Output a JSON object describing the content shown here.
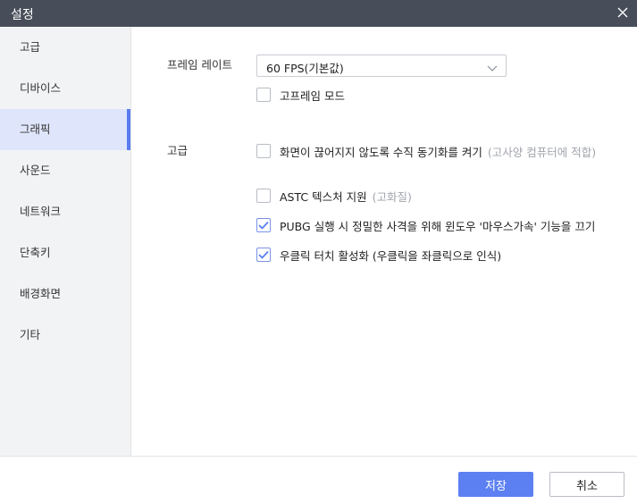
{
  "window": {
    "title": "설정"
  },
  "sidebar": {
    "items": [
      {
        "label": "고급",
        "active": false
      },
      {
        "label": "디바이스",
        "active": false
      },
      {
        "label": "그래픽",
        "active": true
      },
      {
        "label": "사운드",
        "active": false
      },
      {
        "label": "네트워크",
        "active": false
      },
      {
        "label": "단축키",
        "active": false
      },
      {
        "label": "배경화면",
        "active": false
      },
      {
        "label": "기타",
        "active": false
      }
    ]
  },
  "framerate": {
    "label": "프레임 레이트",
    "selected": "60 FPS(기본값)",
    "high_frame_mode": {
      "label": "고프레임 모드",
      "checked": false
    }
  },
  "advanced": {
    "label": "고급",
    "vsync": {
      "label": "화면이 끊어지지 않도록 수직 동기화를 켜기",
      "hint": "(고사양 컴퓨터에 적합)",
      "checked": false
    },
    "astc": {
      "label": "ASTC 텍스처 지원",
      "hint": "(고화질)",
      "checked": false
    },
    "pubg_mouse": {
      "label": "PUBG 실행 시 정밀한 사격을 위해 윈도우 '마우스가속' 기능을 끄기",
      "checked": true
    },
    "right_click_touch": {
      "label": "우클릭 터치 활성화 (우클릭을 좌클릭으로 인식)",
      "checked": true
    }
  },
  "footer": {
    "save_label": "저장",
    "cancel_label": "취소"
  },
  "colors": {
    "accent": "#5c80f2",
    "titlebar": "#474e59",
    "sidebar_active": "#dfe5fb"
  }
}
